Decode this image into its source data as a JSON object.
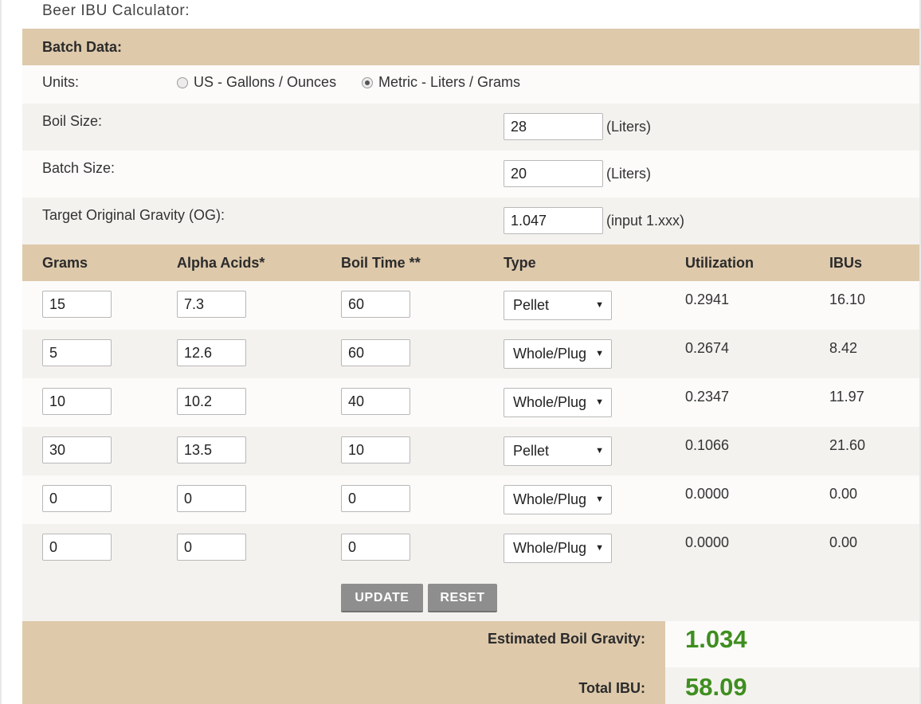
{
  "title": "Beer IBU Calculator:",
  "batch": {
    "section_label": "Batch Data:",
    "units_label": "Units:",
    "unit_options": [
      {
        "label": "US - Gallons / Ounces",
        "selected": false
      },
      {
        "label": "Metric - Liters / Grams",
        "selected": true
      }
    ],
    "fields": [
      {
        "label": "Boil Size:",
        "value": "28",
        "unit": "(Liters)"
      },
      {
        "label": "Batch Size:",
        "value": "20",
        "unit": "(Liters)"
      },
      {
        "label": "Target Original Gravity (OG):",
        "value": "1.047",
        "unit": "(input 1.xxx)"
      }
    ]
  },
  "hops": {
    "headers": [
      "Grams",
      "Alpha Acids*",
      "Boil Time **",
      "Type",
      "Utilization",
      "IBUs"
    ],
    "rows": [
      {
        "grams": "15",
        "alpha": "7.3",
        "time": "60",
        "type": "Pellet",
        "utilization": "0.2941",
        "ibus": "16.10"
      },
      {
        "grams": "5",
        "alpha": "12.6",
        "time": "60",
        "type": "Whole/Plug",
        "utilization": "0.2674",
        "ibus": "8.42"
      },
      {
        "grams": "10",
        "alpha": "10.2",
        "time": "40",
        "type": "Whole/Plug",
        "utilization": "0.2347",
        "ibus": "11.97"
      },
      {
        "grams": "30",
        "alpha": "13.5",
        "time": "10",
        "type": "Pellet",
        "utilization": "0.1066",
        "ibus": "21.60"
      },
      {
        "grams": "0",
        "alpha": "0",
        "time": "0",
        "type": "Whole/Plug",
        "utilization": "0.0000",
        "ibus": "0.00"
      },
      {
        "grams": "0",
        "alpha": "0",
        "time": "0",
        "type": "Whole/Plug",
        "utilization": "0.0000",
        "ibus": "0.00"
      }
    ]
  },
  "buttons": {
    "update": "UPDATE",
    "reset": "RESET"
  },
  "results": {
    "boil_gravity_label": "Estimated Boil Gravity:",
    "boil_gravity_value": "1.034",
    "total_ibu_label": "Total IBU:",
    "total_ibu_value": "58.09"
  },
  "colors": {
    "header_band": "#dec9ab",
    "result_value": "#3e8e1f",
    "button": "#8e8e8e"
  },
  "icons": {
    "select_arrow": "dropdown-arrow-icon"
  }
}
